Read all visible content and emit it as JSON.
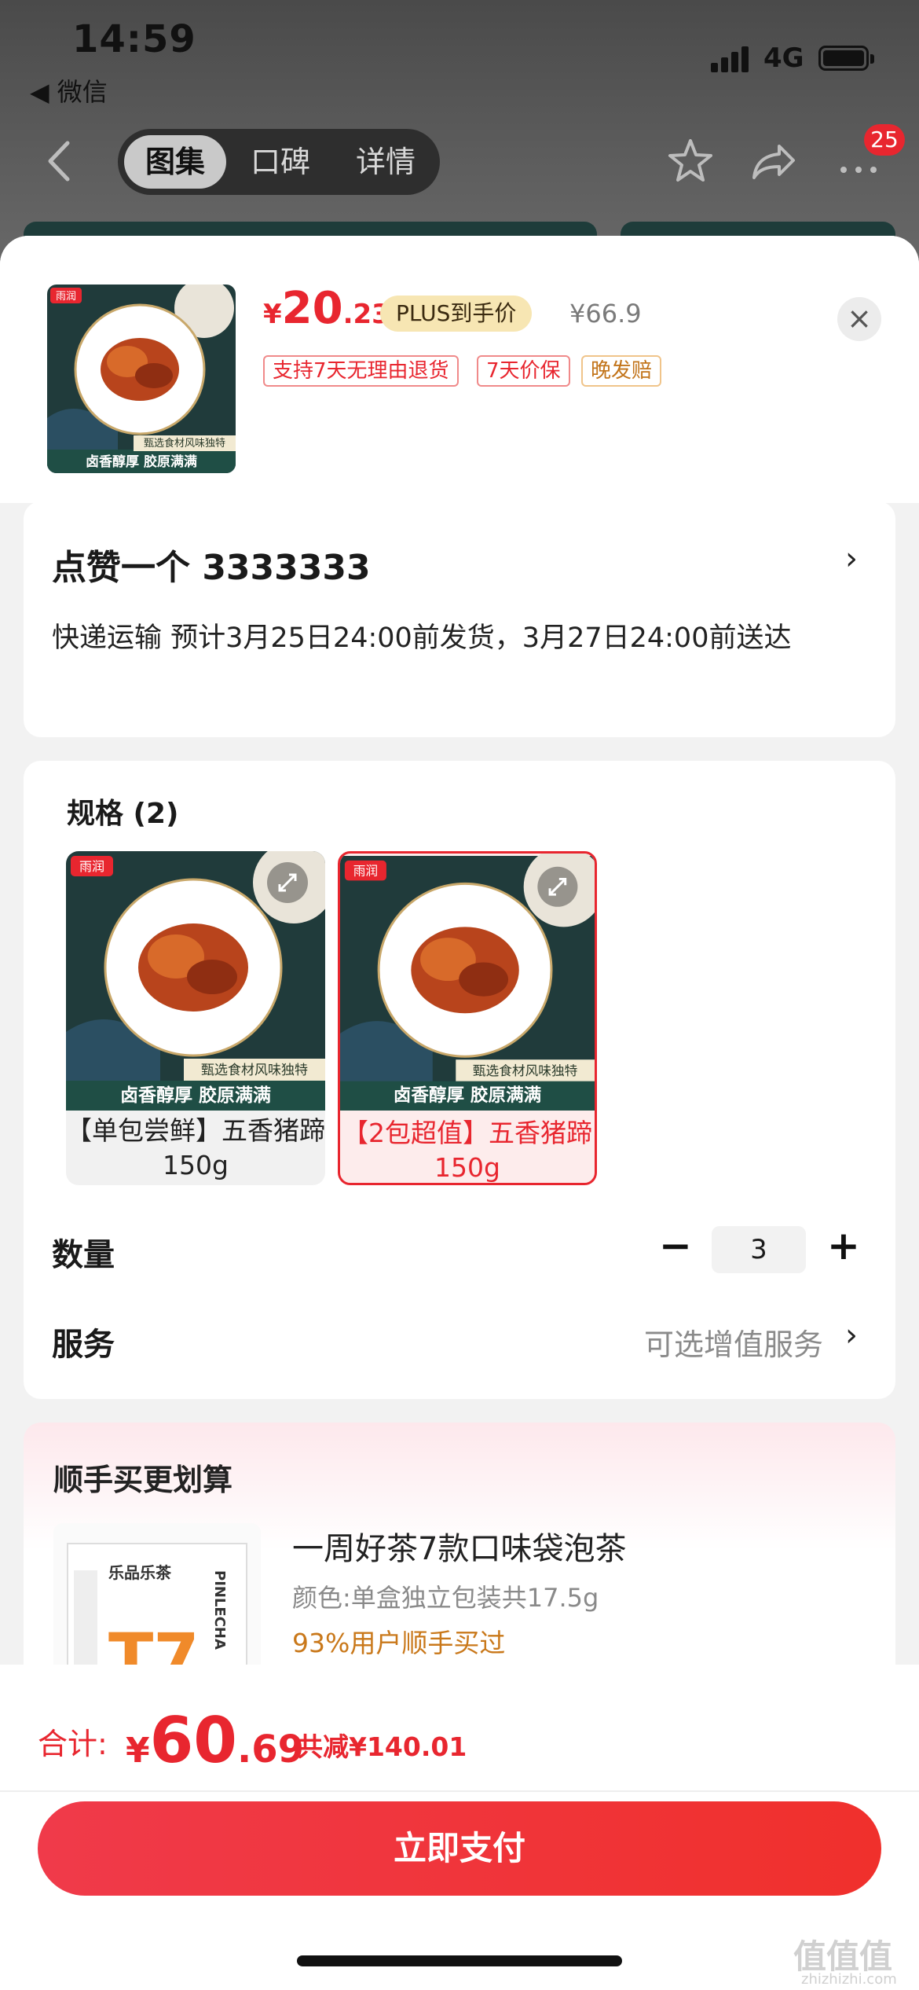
{
  "status_bar": {
    "time": "14:59",
    "back_app": "◀ 微信",
    "network": "4G"
  },
  "nav": {
    "tabs": [
      "图集",
      "口碑",
      "详情"
    ],
    "active_tab": "图集",
    "cart_badge": "25"
  },
  "product": {
    "price_currency": "¥",
    "price_int": "20",
    "price_dec": ".23",
    "plus_label": "PLUS到手价",
    "original_price": "¥66.9",
    "tags": [
      "支持7天无理由退货",
      "7天价保",
      "晚发赔"
    ],
    "image_caption_top": "甄选食材风味独特",
    "image_caption_bottom": "卤香醇厚 胶原满满",
    "brand_mark": "雨润"
  },
  "address": {
    "name": "点赞一个  3333333",
    "shipping": "快递运输 预计3月25日24:00前发货，3月27日24:00前送达"
  },
  "spec": {
    "title": "规格 (2)",
    "options": [
      {
        "label": "【单包尝鲜】五香猪蹄150g"
      },
      {
        "label": "【2包超值】五香猪蹄150g"
      }
    ]
  },
  "quantity": {
    "label": "数量",
    "value": "3"
  },
  "service": {
    "label": "服务",
    "hint": "可选增值服务"
  },
  "bundle": {
    "title": "顺手买更划算",
    "item_name": "一周好茶7款口味袋泡茶",
    "item_spec": "颜色:单盒独立包装共17.5g",
    "item_social": "93%用户顺手买过",
    "item_brand": "乐品乐茶",
    "item_logo": "T7",
    "item_pinyin": "PINLECHA"
  },
  "checkout": {
    "total_label": "合计:",
    "total_currency": "¥",
    "total_int": "60",
    "total_dec": ".69",
    "discount": "共减¥140.01",
    "pay_button": "立即支付"
  },
  "watermark": {
    "text": "值值值",
    "url": "zhizhizhi.com"
  },
  "colors": {
    "accent_red": "#e8262f",
    "plus_gold": "#f7e6b3",
    "dish_green": "#1e3c3a"
  }
}
